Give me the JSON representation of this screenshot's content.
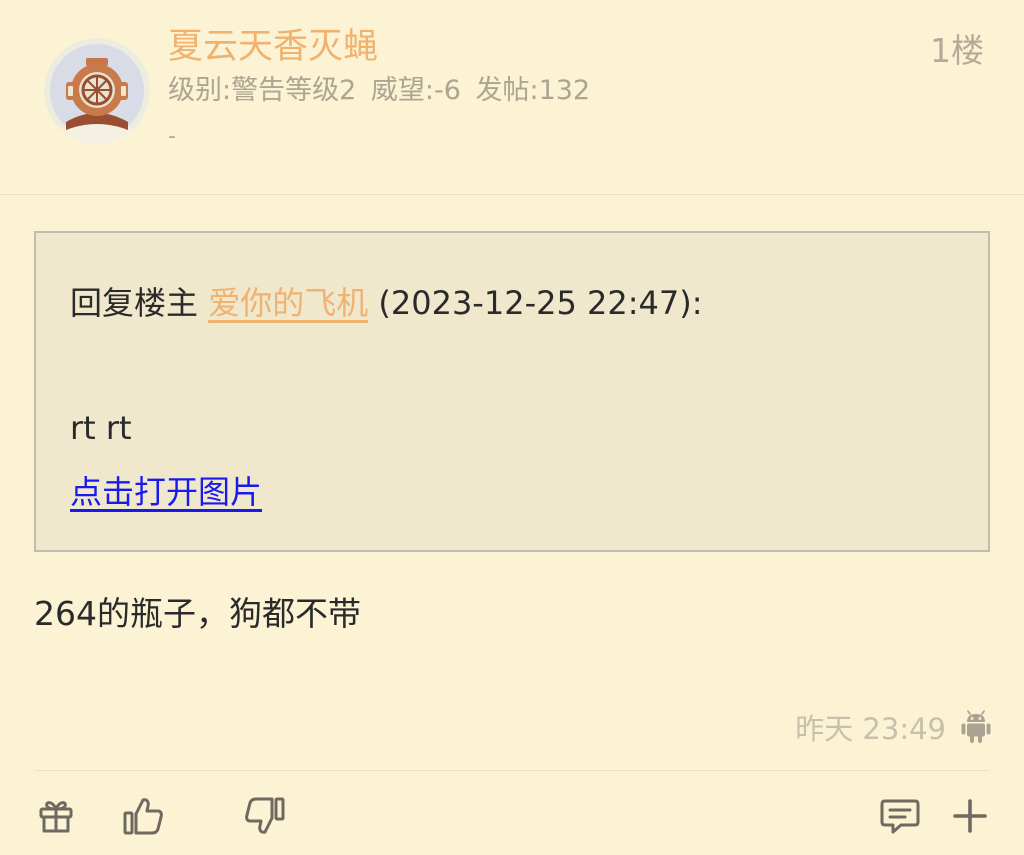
{
  "post": {
    "username": "夏云天香灭蝇",
    "floor": "1楼",
    "meta": {
      "level": "级别:警告等级2",
      "reputation": "威望:-6",
      "posts": "发帖:132"
    },
    "signature": "-",
    "quote": {
      "prefix": "回复楼主",
      "author": "爱你的飞机",
      "datetime": "(2023-12-25 22:47):",
      "body": "rt rt",
      "image_link": "点击打开图片"
    },
    "content": "264的瓶子，狗都不带",
    "timestamp": "昨天 23:49",
    "device_icon": "android-icon"
  },
  "actions": {
    "icons": [
      "gift-icon",
      "thumbs-up-icon",
      "thumbs-down-icon",
      "comment-icon",
      "plus-icon"
    ]
  },
  "colors": {
    "background": "#fcf3d4",
    "username": "#f0b26e",
    "muted": "#aba592",
    "link": "#1a1aee",
    "quote_background": "#f0e8cd",
    "quote_border": "#bfbcb0"
  }
}
